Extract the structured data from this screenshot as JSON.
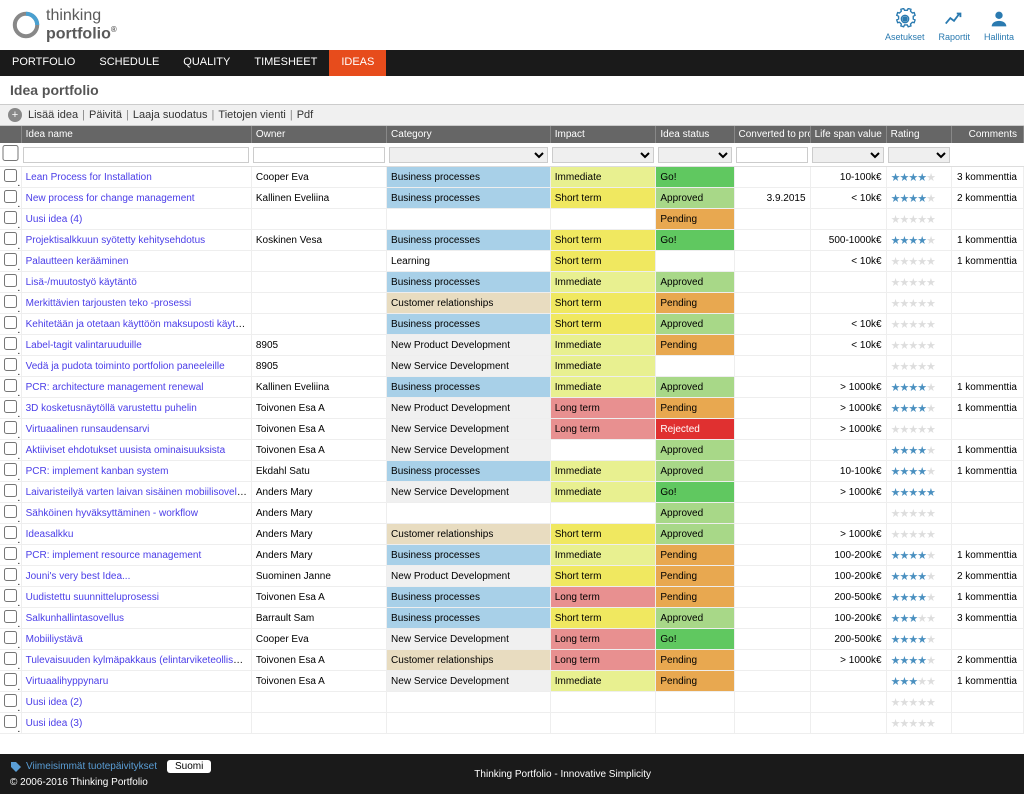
{
  "brand": {
    "line1": "thinking",
    "line2": "portfolio"
  },
  "header_actions": [
    {
      "label": "Asetukset",
      "icon": "gear"
    },
    {
      "label": "Raportit",
      "icon": "chart"
    },
    {
      "label": "Hallinta",
      "icon": "user"
    }
  ],
  "nav": [
    "PORTFOLIO",
    "SCHEDULE",
    "QUALITY",
    "TIMESHEET",
    "IDEAS"
  ],
  "nav_active": "IDEAS",
  "page_title": "Idea portfolio",
  "toolbar": {
    "add": "Lisää idea",
    "refresh": "Päivitä",
    "filter": "Laaja suodatus",
    "export": "Tietojen vienti",
    "pdf": "Pdf"
  },
  "columns": [
    "",
    "Idea name",
    "Owner",
    "Category",
    "Impact",
    "Idea status",
    "Converted to pro",
    "Life span value",
    "Rating",
    "Comments"
  ],
  "rows": [
    {
      "name": "Lean Process for Installation",
      "owner": "Cooper Eva",
      "cat": "Business processes",
      "catc": "bp",
      "imp": "Immediate",
      "impc": "imm",
      "st": "Go!",
      "stc": "go",
      "conv": "",
      "life": "10-100k€",
      "rate": 4,
      "comm": "3 kommenttia"
    },
    {
      "name": "New process for change management",
      "owner": "Kallinen Eveliina",
      "cat": "Business processes",
      "catc": "bp",
      "imp": "Short term",
      "impc": "short",
      "st": "Approved",
      "stc": "appr",
      "conv": "3.9.2015",
      "life": "< 10k€",
      "rate": 4,
      "comm": "2 kommenttia"
    },
    {
      "name": "Uusi idea (4)",
      "owner": "",
      "cat": "",
      "catc": "",
      "imp": "",
      "impc": "",
      "st": "Pending",
      "stc": "pend",
      "conv": "",
      "life": "",
      "rate": 0,
      "comm": ""
    },
    {
      "name": "Projektisalkkuun syötetty kehitysehdotus",
      "owner": "Koskinen Vesa",
      "cat": "Business processes",
      "catc": "bp",
      "imp": "Short term",
      "impc": "short",
      "st": "Go!",
      "stc": "go",
      "conv": "",
      "life": "500-1000k€",
      "rate": 4,
      "comm": "1 kommenttia"
    },
    {
      "name": "Palautteen kerääminen",
      "owner": "",
      "cat": "Learning",
      "catc": "learn",
      "imp": "Short term",
      "impc": "short",
      "st": "",
      "stc": "",
      "conv": "",
      "life": "< 10k€",
      "rate": 0,
      "comm": "1 kommenttia"
    },
    {
      "name": "Lisä-/muutostyö käytäntö",
      "owner": "",
      "cat": "Business processes",
      "catc": "bp",
      "imp": "Immediate",
      "impc": "imm",
      "st": "Approved",
      "stc": "appr",
      "conv": "",
      "life": "",
      "rate": 0,
      "comm": ""
    },
    {
      "name": "Merkittävien tarjousten teko -prosessi",
      "owner": "",
      "cat": "Customer relationships",
      "catc": "cr",
      "imp": "Short term",
      "impc": "short",
      "st": "Pending",
      "stc": "pend",
      "conv": "",
      "life": "",
      "rate": 0,
      "comm": ""
    },
    {
      "name": "Kehitetään ja otetaan käyttöön maksuposti käytäntö",
      "owner": "",
      "cat": "Business processes",
      "catc": "bp",
      "imp": "Short term",
      "impc": "short",
      "st": "Approved",
      "stc": "appr",
      "conv": "",
      "life": "< 10k€",
      "rate": 0,
      "comm": ""
    },
    {
      "name": "Label-tagit valintaruuduille",
      "owner": "8905",
      "cat": "New Product Development",
      "catc": "npd",
      "imp": "Immediate",
      "impc": "imm",
      "st": "Pending",
      "stc": "pend",
      "conv": "",
      "life": "< 10k€",
      "rate": 0,
      "comm": ""
    },
    {
      "name": "Vedä ja pudota toiminto portfolion paneeleille",
      "owner": "8905",
      "cat": "New Service Development",
      "catc": "nsd",
      "imp": "Immediate",
      "impc": "imm",
      "st": "",
      "stc": "",
      "conv": "",
      "life": "",
      "rate": 0,
      "comm": ""
    },
    {
      "name": "PCR: architecture management renewal",
      "owner": "Kallinen Eveliina",
      "cat": "Business processes",
      "catc": "bp",
      "imp": "Immediate",
      "impc": "imm",
      "st": "Approved",
      "stc": "appr",
      "conv": "",
      "life": "> 1000k€",
      "rate": 4,
      "comm": "1 kommenttia"
    },
    {
      "name": "3D kosketusnäytöllä varustettu puhelin",
      "owner": "Toivonen Esa A",
      "cat": "New Product Development",
      "catc": "npd",
      "imp": "Long term",
      "impc": "long",
      "st": "Pending",
      "stc": "pend",
      "conv": "",
      "life": "> 1000k€",
      "rate": 4,
      "comm": "1 kommenttia"
    },
    {
      "name": "Virtuaalinen runsaudensarvi",
      "owner": "Toivonen Esa A",
      "cat": "New Service Development",
      "catc": "nsd",
      "imp": "Long term",
      "impc": "long",
      "st": "Rejected",
      "stc": "rej",
      "conv": "",
      "life": "> 1000k€",
      "rate": 0,
      "comm": ""
    },
    {
      "name": "Aktiiviset ehdotukset uusista ominaisuuksista",
      "owner": "Toivonen Esa A",
      "cat": "New Service Development",
      "catc": "nsd",
      "imp": "",
      "impc": "",
      "st": "Approved",
      "stc": "appr",
      "conv": "",
      "life": "",
      "rate": 4,
      "comm": "1 kommenttia"
    },
    {
      "name": "PCR: implement kanban system",
      "owner": "Ekdahl Satu",
      "cat": "Business processes",
      "catc": "bp",
      "imp": "Immediate",
      "impc": "imm",
      "st": "Approved",
      "stc": "appr",
      "conv": "",
      "life": "10-100k€",
      "rate": 4,
      "comm": "1 kommenttia"
    },
    {
      "name": "Laivaristeilyä varten laivan sisäinen mobiilisovellus",
      "owner": "Anders Mary",
      "cat": "New Service Development",
      "catc": "nsd",
      "imp": "Immediate",
      "impc": "imm",
      "st": "Go!",
      "stc": "go",
      "conv": "",
      "life": "> 1000k€",
      "rate": 5,
      "comm": ""
    },
    {
      "name": "Sähköinen hyväksyttäminen - workflow",
      "owner": "Anders Mary",
      "cat": "",
      "catc": "",
      "imp": "",
      "impc": "",
      "st": "Approved",
      "stc": "appr",
      "conv": "",
      "life": "",
      "rate": 0,
      "comm": ""
    },
    {
      "name": "Ideasalkku",
      "owner": "Anders Mary",
      "cat": "Customer relationships",
      "catc": "cr",
      "imp": "Short term",
      "impc": "short",
      "st": "Approved",
      "stc": "appr",
      "conv": "",
      "life": "> 1000k€",
      "rate": 0,
      "comm": ""
    },
    {
      "name": "PCR: implement resource management",
      "owner": "Anders Mary",
      "cat": "Business processes",
      "catc": "bp",
      "imp": "Immediate",
      "impc": "imm",
      "st": "Pending",
      "stc": "pend",
      "conv": "",
      "life": "100-200k€",
      "rate": 4,
      "comm": "1 kommenttia"
    },
    {
      "name": "Jouni's very best Idea...",
      "owner": "Suominen Janne",
      "cat": "New Product Development",
      "catc": "npd",
      "imp": "Short term",
      "impc": "short",
      "st": "Pending",
      "stc": "pend",
      "conv": "",
      "life": "100-200k€",
      "rate": 4,
      "comm": "2 kommenttia"
    },
    {
      "name": "Uudistettu suunnitteluprosessi",
      "owner": "Toivonen Esa A",
      "cat": "Business processes",
      "catc": "bp",
      "imp": "Long term",
      "impc": "long",
      "st": "Pending",
      "stc": "pend",
      "conv": "",
      "life": "200-500k€",
      "rate": 4,
      "comm": "1 kommenttia"
    },
    {
      "name": "Salkunhallintasovellus",
      "owner": "Barrault Sam",
      "cat": "Business processes",
      "catc": "bp",
      "imp": "Short term",
      "impc": "short",
      "st": "Approved",
      "stc": "appr",
      "conv": "",
      "life": "100-200k€",
      "rate": 3,
      "comm": "3 kommenttia"
    },
    {
      "name": "Mobiiliystävä",
      "owner": "Cooper Eva",
      "cat": "New Service Development",
      "catc": "nsd",
      "imp": "Long term",
      "impc": "long",
      "st": "Go!",
      "stc": "go",
      "conv": "",
      "life": "200-500k€",
      "rate": 4,
      "comm": ""
    },
    {
      "name": "Tulevaisuuden kylmäpakkaus (elintarviketeollisuus)",
      "owner": "Toivonen Esa A",
      "cat": "Customer relationships",
      "catc": "cr",
      "imp": "Long term",
      "impc": "long",
      "st": "Pending",
      "stc": "pend",
      "conv": "",
      "life": "> 1000k€",
      "rate": 4,
      "comm": "2 kommenttia"
    },
    {
      "name": "Virtuaalihyppynaru",
      "owner": "Toivonen Esa A",
      "cat": "New Service Development",
      "catc": "nsd",
      "imp": "Immediate",
      "impc": "imm",
      "st": "Pending",
      "stc": "pend",
      "conv": "",
      "life": "",
      "rate": 3,
      "comm": "1 kommenttia"
    },
    {
      "name": "Uusi idea (2)",
      "owner": "",
      "cat": "",
      "catc": "",
      "imp": "",
      "impc": "",
      "st": "",
      "stc": "",
      "conv": "",
      "life": "",
      "rate": 0,
      "comm": ""
    },
    {
      "name": "Uusi idea (3)",
      "owner": "",
      "cat": "",
      "catc": "",
      "imp": "",
      "impc": "",
      "st": "",
      "stc": "",
      "conv": "",
      "life": "",
      "rate": 0,
      "comm": ""
    }
  ],
  "footer": {
    "updates": "Viimeisimmät tuotepäivitykset",
    "lang": "Suomi",
    "tagline": "Thinking Portfolio - Innovative Simplicity",
    "copyright": "© 2006-2016 Thinking Portfolio"
  }
}
